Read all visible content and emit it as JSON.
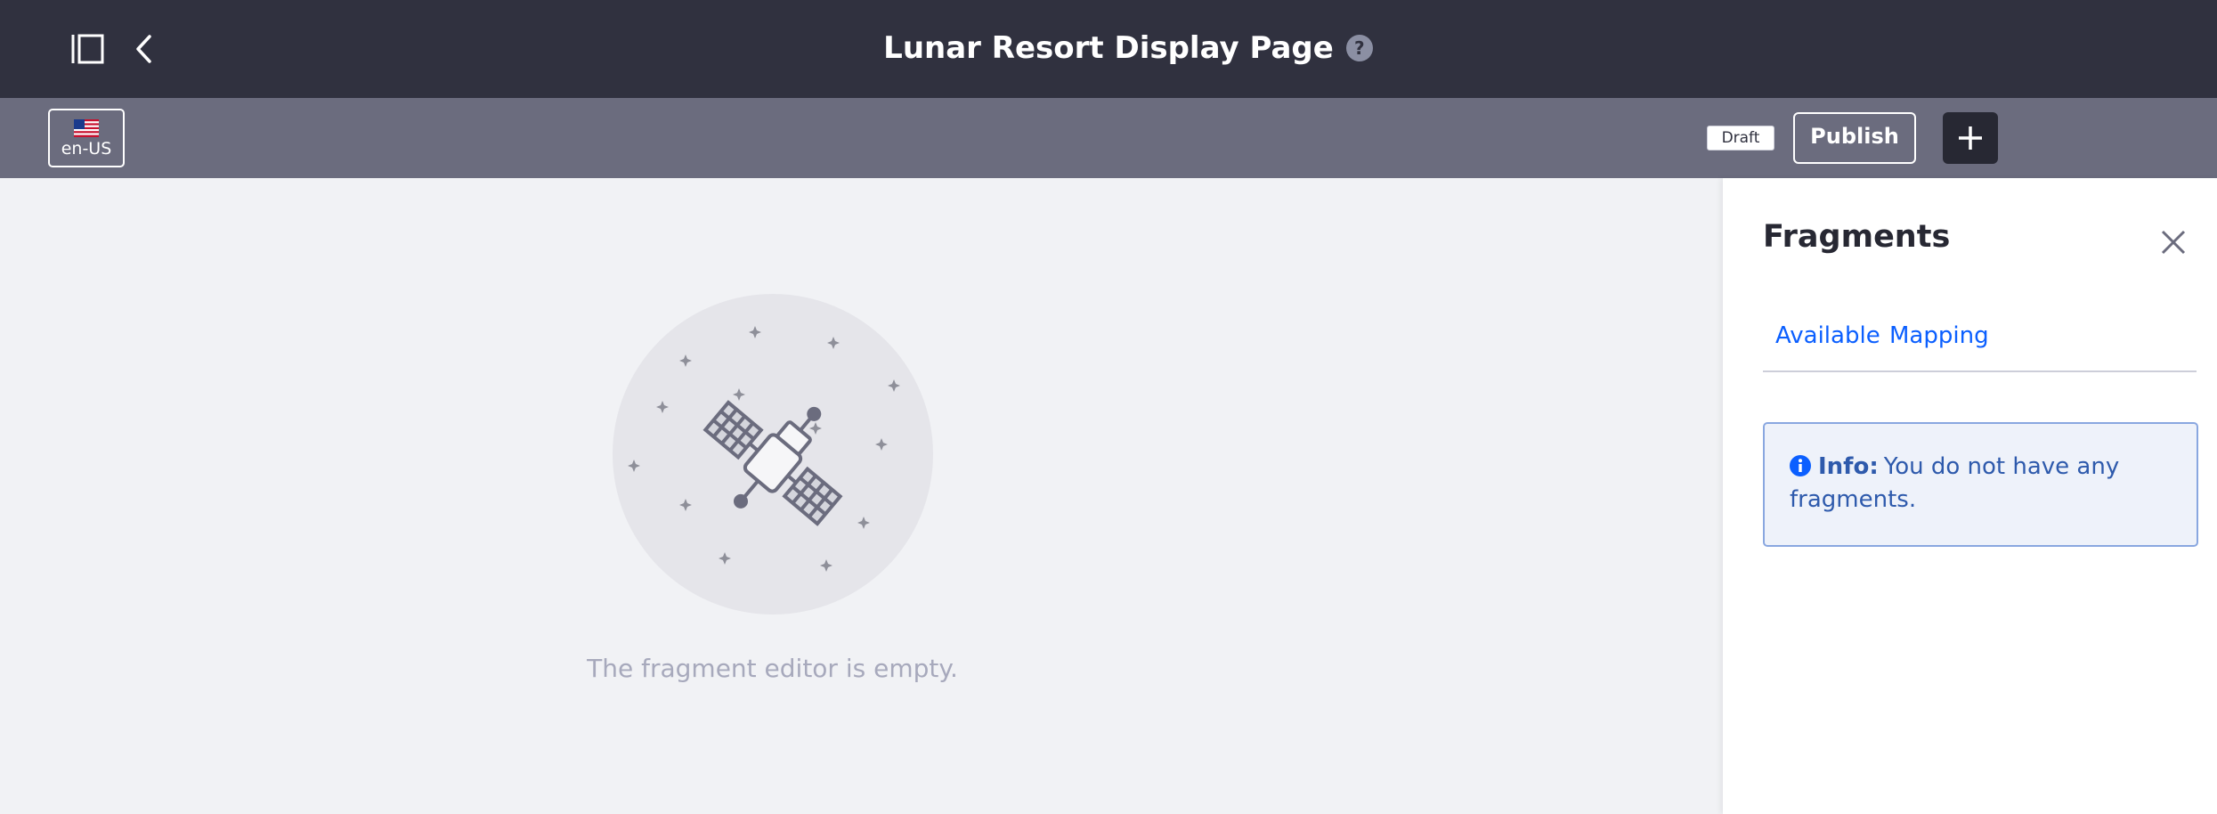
{
  "header": {
    "title": "Lunar Resort Display Page",
    "help_icon": "question-mark-icon",
    "help_symbol": "?",
    "sidebar_toggle_icon": "sidebar-toggle-icon",
    "back_icon": "chevron-left-icon"
  },
  "toolbar": {
    "language": "en-US",
    "language_icon": "us-flag-icon",
    "status_badge": "Draft",
    "publish_label": "Publish",
    "add_icon": "plus-icon"
  },
  "editor": {
    "empty_message": "The fragment editor is empty.",
    "illustration": "satellite-illustration"
  },
  "panel": {
    "title": "Fragments",
    "close_icon": "close-icon",
    "tabs": [
      {
        "label": "Available"
      },
      {
        "label": "Mapping"
      }
    ],
    "alert": {
      "icon": "info-icon",
      "label": "Info:",
      "message": "You do not have any fragments."
    }
  },
  "colors": {
    "header_bg": "#30313f",
    "toolbar_bg": "#6b6c7e",
    "canvas_bg": "#f1f2f5",
    "link": "#0b5fff",
    "alert_text": "#2e5aac"
  }
}
